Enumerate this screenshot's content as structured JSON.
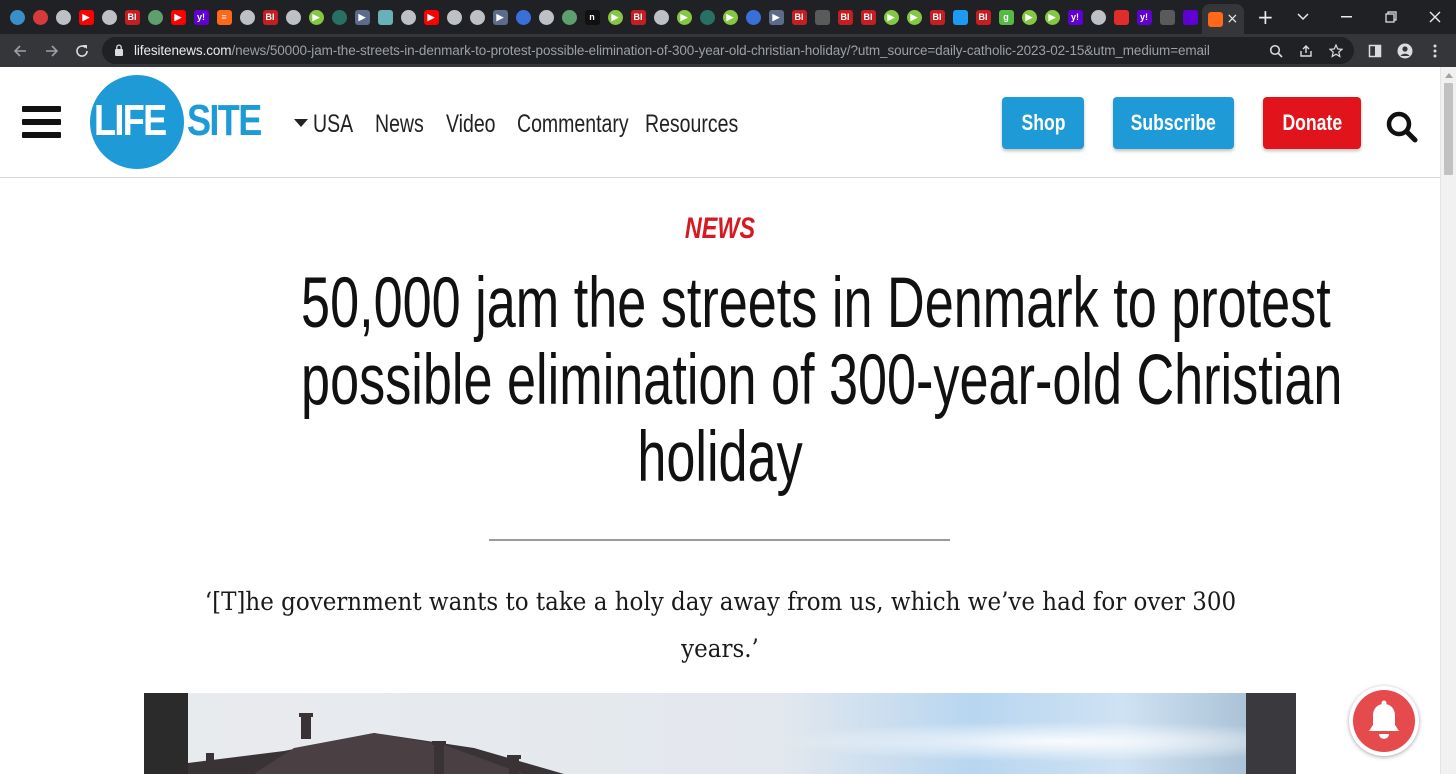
{
  "browser": {
    "tab_favicons": [
      {
        "icon": "globe-icon",
        "color": "#3c8ec9",
        "glyph": "",
        "round": true
      },
      {
        "icon": "soccer-icon",
        "color": "#d63b3b",
        "glyph": "",
        "round": true
      },
      {
        "icon": "chrome-page-icon",
        "color": "#bdc1c6",
        "glyph": "",
        "round": true
      },
      {
        "icon": "youtube-icon",
        "color": "#ff0000",
        "glyph": "▶",
        "round": false
      },
      {
        "icon": "chrome-page-icon",
        "color": "#bdc1c6",
        "glyph": "",
        "round": true
      },
      {
        "icon": "bi-icon",
        "color": "#c41e22",
        "glyph": "BI",
        "round": false
      },
      {
        "icon": "globe-icon",
        "color": "#5f9f6f",
        "glyph": "",
        "round": true
      },
      {
        "icon": "youtube-icon",
        "color": "#ff0000",
        "glyph": "▶",
        "round": false
      },
      {
        "icon": "yahoo-icon",
        "color": "#6001d2",
        "glyph": "y!",
        "round": false
      },
      {
        "icon": "substack-icon",
        "color": "#ff6719",
        "glyph": "≡",
        "round": false
      },
      {
        "icon": "chrome-page-icon",
        "color": "#bdc1c6",
        "glyph": "",
        "round": true
      },
      {
        "icon": "bi-icon",
        "color": "#c41e22",
        "glyph": "BI",
        "round": false
      },
      {
        "icon": "chrome-page-icon",
        "color": "#bdc1c6",
        "glyph": "",
        "round": true
      },
      {
        "icon": "rumble-icon",
        "color": "#85c742",
        "glyph": "▶",
        "round": true
      },
      {
        "icon": "shield-icon",
        "color": "#2a6f63",
        "glyph": "",
        "round": true
      },
      {
        "icon": "play-icon",
        "color": "#5d6b8a",
        "glyph": "▶",
        "round": false
      },
      {
        "icon": "map-icon",
        "color": "#6ab0b8",
        "glyph": "",
        "round": false
      },
      {
        "icon": "chrome-page-icon",
        "color": "#bdc1c6",
        "glyph": "",
        "round": true
      },
      {
        "icon": "youtube-icon",
        "color": "#ff0000",
        "glyph": "▶",
        "round": false
      },
      {
        "icon": "chrome-page-icon",
        "color": "#bdc1c6",
        "glyph": "",
        "round": true
      },
      {
        "icon": "chrome-page-icon",
        "color": "#bdc1c6",
        "glyph": "",
        "round": true
      },
      {
        "icon": "play-icon",
        "color": "#5d6b8a",
        "glyph": "▶",
        "round": false
      },
      {
        "icon": "search-icon",
        "color": "#3b6fd8",
        "glyph": "",
        "round": true
      },
      {
        "icon": "chrome-page-icon",
        "color": "#bdc1c6",
        "glyph": "",
        "round": true
      },
      {
        "icon": "globe-icon",
        "color": "#5f9f6f",
        "glyph": "",
        "round": true
      },
      {
        "icon": "n-icon",
        "color": "#111111",
        "glyph": "n",
        "round": false
      },
      {
        "icon": "rumble-icon",
        "color": "#85c742",
        "glyph": "▶",
        "round": true
      },
      {
        "icon": "bi-icon",
        "color": "#c41e22",
        "glyph": "BI",
        "round": false
      },
      {
        "icon": "chrome-page-icon",
        "color": "#bdc1c6",
        "glyph": "",
        "round": true
      },
      {
        "icon": "rumble-icon",
        "color": "#85c742",
        "glyph": "▶",
        "round": true
      },
      {
        "icon": "shield-icon",
        "color": "#2a6f63",
        "glyph": "",
        "round": true
      },
      {
        "icon": "rumble-icon",
        "color": "#85c742",
        "glyph": "▶",
        "round": true
      },
      {
        "icon": "search-icon",
        "color": "#3b6fd8",
        "glyph": "",
        "round": true
      },
      {
        "icon": "play-icon",
        "color": "#5d6b8a",
        "glyph": "▶",
        "round": false
      },
      {
        "icon": "bi-icon",
        "color": "#c41e22",
        "glyph": "BI",
        "round": false
      },
      {
        "icon": "lili-icon",
        "color": "#5a5a5a",
        "glyph": "",
        "round": false
      },
      {
        "icon": "bi-icon",
        "color": "#c41e22",
        "glyph": "BI",
        "round": false
      },
      {
        "icon": "bi-icon",
        "color": "#c41e22",
        "glyph": "BI",
        "round": false
      },
      {
        "icon": "rumble-icon",
        "color": "#85c742",
        "glyph": "▶",
        "round": true
      },
      {
        "icon": "rumble-icon",
        "color": "#85c742",
        "glyph": "▶",
        "round": true
      },
      {
        "icon": "bi-icon",
        "color": "#c41e22",
        "glyph": "BI",
        "round": false
      },
      {
        "icon": "twitter-icon",
        "color": "#1d9bf0",
        "glyph": "",
        "round": false
      },
      {
        "icon": "bi-icon",
        "color": "#c41e22",
        "glyph": "BI",
        "round": false
      },
      {
        "icon": "g-icon",
        "color": "#56b947",
        "glyph": "g",
        "round": false
      },
      {
        "icon": "rumble-icon",
        "color": "#85c742",
        "glyph": "▶",
        "round": true
      },
      {
        "icon": "rumble-icon",
        "color": "#85c742",
        "glyph": "▶",
        "round": true
      },
      {
        "icon": "yahoo-icon",
        "color": "#6001d2",
        "glyph": "y!",
        "round": false
      },
      {
        "icon": "chrome-page-icon",
        "color": "#bdc1c6",
        "glyph": "",
        "round": true
      },
      {
        "icon": "podcast-icon",
        "color": "#e22b2b",
        "glyph": "",
        "round": false
      },
      {
        "icon": "yahoo-icon",
        "color": "#6001d2",
        "glyph": "y!",
        "round": false
      },
      {
        "icon": "lili-icon",
        "color": "#5a5a5a",
        "glyph": "",
        "round": false
      },
      {
        "icon": "yahoo-mail-icon",
        "color": "#6001d2",
        "glyph": "",
        "round": false
      }
    ],
    "active_tab_favicon": {
      "icon": "substack-icon",
      "color": "#ff6719"
    },
    "new_tab_label": "+",
    "url_host": "lifesitenews.com",
    "url_path": "/news/50000-jam-the-streets-in-denmark-to-protest-possible-elimination-of-300-year-old-christian-holiday/?utm_source=daily-catholic-2023-02-15&utm_medium=email"
  },
  "site": {
    "brand_color": "#1e9ad6",
    "donate_color": "#e1131b",
    "logo": {
      "left": "LIFE",
      "right": "SITE"
    },
    "nav": {
      "region": "USA",
      "items": [
        "News",
        "Video",
        "Commentary",
        "Resources"
      ]
    },
    "buttons": {
      "shop": "Shop",
      "subscribe": "Subscribe",
      "donate": "Donate"
    }
  },
  "article": {
    "kicker": "NEWS",
    "kicker_color": "#d51a22",
    "headline_lines": [
      "50,000 jam the streets in Denmark to protest",
      "possible elimination of 300-year-old Christian",
      "holiday"
    ],
    "subtitle_lines": [
      "‘[T]he government wants to take a holy day away from us, which we’ve had for over 300",
      "years.’"
    ]
  },
  "notification_bell": {
    "icon": "bell-icon",
    "color": "#e54b4d"
  }
}
